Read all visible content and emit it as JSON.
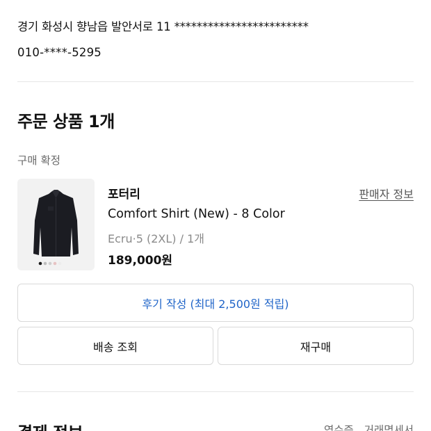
{
  "shipping": {
    "address": "경기 화성시 향남읍 발안서로 11 ************************",
    "phone": "010-****-5295"
  },
  "order": {
    "title": "주문 상품 1개",
    "status": "구매 확정"
  },
  "product": {
    "image_icon": "shirt-image",
    "brand": "포터리",
    "seller_link": "판매자 정보",
    "name": "Comfort Shirt (New) - 8 Color",
    "option": "Ecru·5 (2XL) / 1개",
    "price": "189,000원",
    "swatch_colors": [
      "#1a1a1a",
      "#bdbdbd",
      "#cfcfcf",
      "#e7c3c3",
      "#ececec"
    ],
    "shirt_color": "#1b1c22"
  },
  "actions": {
    "review_button": "후기 작성 (최대 2,500원 적립)",
    "track_button": "배송 조회",
    "rebuy_button": "재구매"
  },
  "payment": {
    "title": "결제 정보",
    "receipt_link": "영수증",
    "statement_link": "거래명세서"
  },
  "colors": {
    "accent": "#1f64c8",
    "muted_text": "#6b6b6b",
    "border": "#d9d9d9"
  }
}
